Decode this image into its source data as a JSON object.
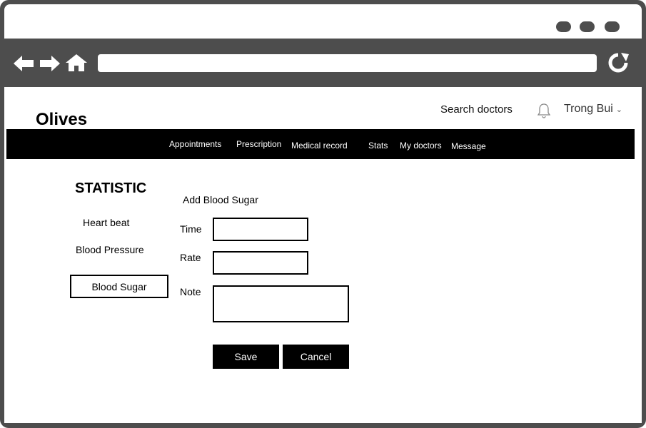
{
  "app": {
    "brand": "Olives"
  },
  "header": {
    "search_label": "Search doctors",
    "user_name": "Trong Bui"
  },
  "menu": {
    "items": [
      {
        "label": "Appointments"
      },
      {
        "label": "Prescription"
      },
      {
        "label": "Medical record"
      },
      {
        "label": "Stats"
      },
      {
        "label": "My doctors"
      },
      {
        "label": "Message"
      }
    ]
  },
  "sidebar": {
    "title": "STATISTIC",
    "items": [
      {
        "label": "Heart beat"
      },
      {
        "label": "Blood Pressure"
      },
      {
        "label": "Blood Sugar",
        "active": true
      }
    ]
  },
  "form": {
    "title": "Add Blood Sugar",
    "fields": [
      {
        "label": "Time",
        "value": "",
        "placeholder": ""
      },
      {
        "label": "Rate",
        "value": "",
        "placeholder": ""
      },
      {
        "label": "Note",
        "value": "",
        "placeholder": ""
      }
    ],
    "save_label": "Save",
    "cancel_label": "Cancel"
  },
  "icons": {
    "back": "arrow-left-icon",
    "forward": "arrow-right-icon",
    "home": "home-icon",
    "reload": "reload-icon",
    "notifications": "bell-icon",
    "user_menu": "chevron-down-icon"
  },
  "colors": {
    "chrome": "#4d4d4d",
    "menubar": "#000000",
    "menu_text": "#ffffff",
    "page_bg": "#ffffff"
  }
}
